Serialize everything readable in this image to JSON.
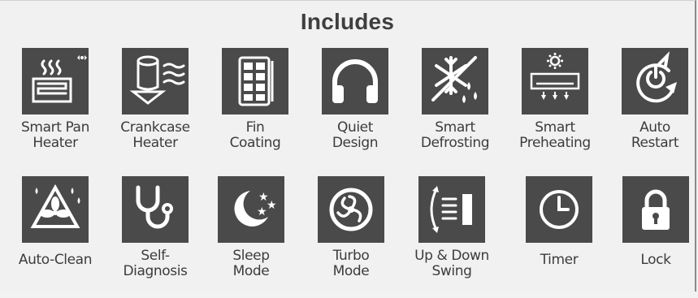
{
  "heading": "Includes",
  "row1": [
    {
      "label": "Smart Pan\nHeater",
      "icon": "smart-pan-heater-icon"
    },
    {
      "label": "Crankcase\nHeater",
      "icon": "crankcase-heater-icon"
    },
    {
      "label": "Fin\nCoating",
      "icon": "fin-coating-icon"
    },
    {
      "label": "Quiet\nDesign",
      "icon": "headphones-icon"
    },
    {
      "label": "Smart\nDefrosting",
      "icon": "snowflake-defrost-icon"
    },
    {
      "label": "Smart\nPreheating",
      "icon": "preheat-unit-icon"
    },
    {
      "label": "Auto\nRestart",
      "icon": "auto-restart-icon"
    }
  ],
  "row2": [
    {
      "label": "Auto-Clean",
      "icon": "auto-clean-fan-icon"
    },
    {
      "label": "Self-\nDiagnosis",
      "icon": "stethoscope-icon"
    },
    {
      "label": "Sleep\nMode",
      "icon": "moon-stars-icon"
    },
    {
      "label": "Turbo\nMode",
      "icon": "turbo-fan-icon"
    },
    {
      "label": "Up & Down\nSwing",
      "icon": "swing-louver-icon"
    },
    {
      "label": "Timer",
      "icon": "clock-icon"
    },
    {
      "label": "Lock",
      "icon": "padlock-icon"
    }
  ],
  "colors": {
    "tile": "#4a4a4a",
    "icon": "#ffffff",
    "text": "#3c3c3c",
    "background": "#f1f1f1"
  }
}
